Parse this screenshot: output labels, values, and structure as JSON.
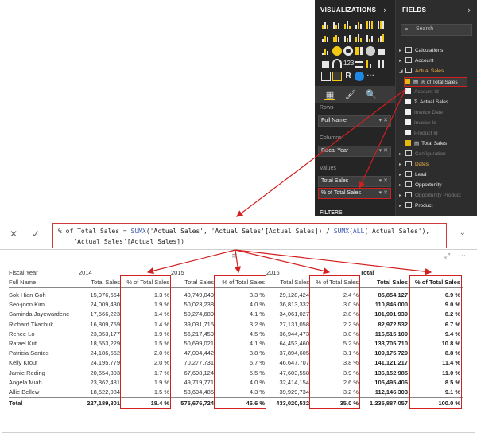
{
  "viz_panel": {
    "title": "VISUALIZATIONS",
    "chevron": "›"
  },
  "fields_panel": {
    "title": "FIELDS",
    "chevron": "›",
    "search_placeholder": "Search"
  },
  "field_wells": {
    "rows_label": "Rows",
    "rows_value": "Full Name",
    "columns_label": "Columns",
    "columns_value": "Fiscal Year",
    "values_label": "Values",
    "values": [
      "Total Sales",
      "% of Total Sales"
    ]
  },
  "fields_list": [
    {
      "label": "Calculations",
      "type": "table"
    },
    {
      "label": "Account",
      "type": "table"
    },
    {
      "label": "Actual Sales",
      "type": "table-open"
    },
    {
      "label": "% of Total Sales",
      "type": "measure-checked"
    },
    {
      "label": "Account Id",
      "type": "field"
    },
    {
      "label": "Actual Sales",
      "type": "sigma"
    },
    {
      "label": "Invoice Date",
      "type": "field"
    },
    {
      "label": "Invoice Id",
      "type": "field"
    },
    {
      "label": "Product Id",
      "type": "field"
    },
    {
      "label": "Total Sales",
      "type": "measure-checked"
    },
    {
      "label": "Configuration",
      "type": "table-dim"
    },
    {
      "label": "Dates",
      "type": "table-orange"
    },
    {
      "label": "Lead",
      "type": "table"
    },
    {
      "label": "Opportunity",
      "type": "table"
    },
    {
      "label": "Opportunity Product",
      "type": "table-dim"
    },
    {
      "label": "Product",
      "type": "table"
    }
  ],
  "filters_partial": "FILTERS",
  "formula": {
    "line1_a": "% of Total Sales = ",
    "line1_fn1": "SUMX",
    "line1_b": "('Actual Sales', 'Actual Sales'[Actual Sales]) / ",
    "line1_fn2": "SUMX",
    "line1_c": "(",
    "line1_fn3": "ALL",
    "line1_d": "('Actual Sales'),",
    "line2": "    'Actual Sales'[Actual Sales])",
    "cancel": "✕",
    "commit": "✓",
    "expand": "⌄"
  },
  "matrix": {
    "fiscal_year_label": "Fiscal Year",
    "full_name_label": "Full Name",
    "years": [
      "2014",
      "2015",
      "2016",
      "Total"
    ],
    "col_headers": [
      "Total Sales",
      "% of Total Sales",
      "Total Sales",
      "% of Total Sales",
      "Total Sales",
      "% of Total Sales",
      "Total Sales",
      "% of Total Sales"
    ],
    "rows": [
      {
        "name": "Sok Hian Goh",
        "v": [
          "15,976,654",
          "1.3 %",
          "40,749,049",
          "3.3 %",
          "29,128,424",
          "2.4 %",
          "85,854,127",
          "6.9 %"
        ]
      },
      {
        "name": "Seo-joon Kim",
        "v": [
          "24,009,430",
          "1.9 %",
          "50,023,238",
          "4.0 %",
          "36,813,332",
          "3.0 %",
          "110,846,000",
          "9.0 %"
        ]
      },
      {
        "name": "Saminda Jayewardene",
        "v": [
          "17,566,223",
          "1.4 %",
          "50,274,689",
          "4.1 %",
          "34,061,027",
          "2.8 %",
          "101,901,939",
          "8.2 %"
        ]
      },
      {
        "name": "Richard Tkachuk",
        "v": [
          "16,809,759",
          "1.4 %",
          "39,031,715",
          "3.2 %",
          "27,131,058",
          "2.2 %",
          "82,972,532",
          "6.7 %"
        ]
      },
      {
        "name": "Renee Lo",
        "v": [
          "23,353,177",
          "1.9 %",
          "56,217,459",
          "4.5 %",
          "36,944,473",
          "3.0 %",
          "116,515,109",
          "9.4 %"
        ]
      },
      {
        "name": "Rafael Krit",
        "v": [
          "18,553,229",
          "1.5 %",
          "50,699,021",
          "4.1 %",
          "64,453,460",
          "5.2 %",
          "133,705,710",
          "10.8 %"
        ]
      },
      {
        "name": "Patricia Santos",
        "v": [
          "24,186,562",
          "2.0 %",
          "47,094,442",
          "3.8 %",
          "37,894,605",
          "3.1 %",
          "109,175,729",
          "8.8 %"
        ]
      },
      {
        "name": "Kelly Krout",
        "v": [
          "24,195,779",
          "2.0 %",
          "70,277,731",
          "5.7 %",
          "46,647,707",
          "3.8 %",
          "141,121,217",
          "11.4 %"
        ]
      },
      {
        "name": "Jamie Reding",
        "v": [
          "20,654,303",
          "1.7 %",
          "67,698,124",
          "5.5 %",
          "47,603,558",
          "3.9 %",
          "136,152,985",
          "11.0 %"
        ]
      },
      {
        "name": "Angela Miah",
        "v": [
          "23,362,481",
          "1.9 %",
          "49,719,771",
          "4.0 %",
          "32,414,154",
          "2.6 %",
          "105,495,406",
          "8.5 %"
        ]
      },
      {
        "name": "Allie Bellew",
        "v": [
          "18,522,084",
          "1.5 %",
          "53,694,485",
          "4.3 %",
          "39,929,734",
          "3.2 %",
          "112,146,303",
          "9.1 %"
        ]
      }
    ],
    "total_row": {
      "name": "Total",
      "v": [
        "227,189,801",
        "18.4 %",
        "575,676,724",
        "46.6 %",
        "433,020,532",
        "35.0 %",
        "1,235,887,057",
        "100.0 %"
      ]
    },
    "toolbar": {
      "grip": "≡",
      "focus": "⤢",
      "more": "⋯"
    }
  },
  "colors": {
    "accent_red": "#d21f1f",
    "pbi_dark": "#2b2b2b",
    "pbi_orange": "#f2b44b",
    "check_yellow": "#e8b80f",
    "dax_blue": "#3b5bb5"
  }
}
